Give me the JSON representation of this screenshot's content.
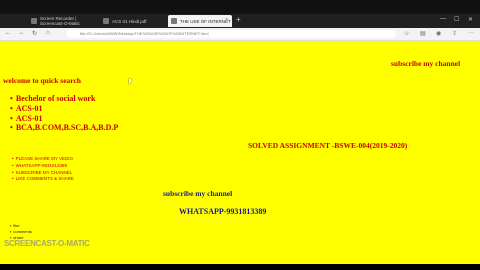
{
  "browser": {
    "tabs": [
      {
        "label": "Screen Recorder | Screencast-O-Matic"
      },
      {
        "label": "ACS 01 Hindi.pdf"
      },
      {
        "label": "THE USE OF INTERNET"
      }
    ],
    "new_tab": "+",
    "url": "file:///C:/Users/WWW/Desktop/THE%20USE%20OF%20INTERNET.html"
  },
  "page": {
    "subscribe_top": "subscribe my channel",
    "welcome": "welcome to quick search",
    "list_items": [
      "Bechelor of social work",
      "ACS-01",
      "ACS-01",
      "BCA,B.COM,B.SC,B.A,B.D.P"
    ],
    "solved": "SOLVED ASSIGNMENT -BSWE-004(2019-2020)",
    "small_items": [
      "PLEASE SHARE MY VEDIO",
      "WHATSAPP-9931813389",
      "SUBSCRIBE MY CHANNEL",
      "LIKE COMMENTS & SHARE"
    ],
    "subscribe_mid": "subscribe my channel",
    "whatsapp": "WHATSAPP-9931813389",
    "tiny_items": [
      "like",
      "comments",
      "share"
    ]
  },
  "overlay": {
    "watermark": "SCREENCAST-O-MATIC"
  }
}
